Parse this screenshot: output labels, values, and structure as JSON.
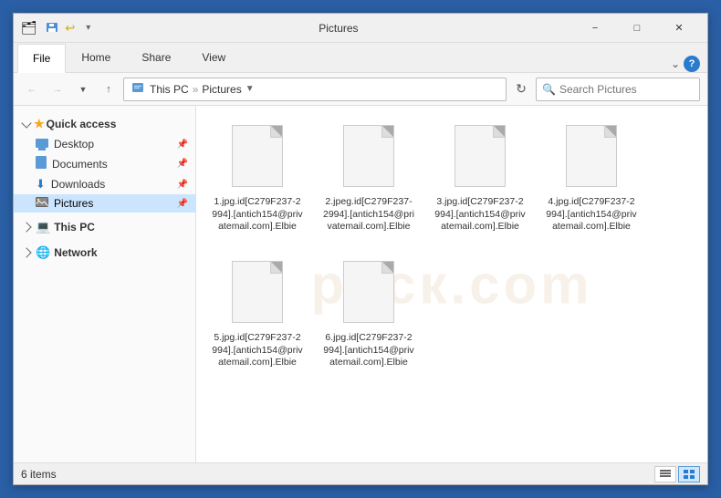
{
  "window": {
    "title": "Pictures",
    "titlebar_icon": "📁"
  },
  "ribbon": {
    "tabs": [
      "File",
      "Home",
      "Share",
      "View"
    ],
    "active_tab": "File"
  },
  "address_bar": {
    "path": [
      "This PC",
      "Pictures"
    ],
    "search_placeholder": "Search Pictures"
  },
  "sidebar": {
    "quick_access_label": "Quick access",
    "items": [
      {
        "id": "desktop",
        "label": "Desktop",
        "pinned": true
      },
      {
        "id": "documents",
        "label": "Documents",
        "pinned": true
      },
      {
        "id": "downloads",
        "label": "Downloads",
        "pinned": true
      },
      {
        "id": "pictures",
        "label": "Pictures",
        "pinned": true,
        "active": true
      }
    ],
    "this_pc_label": "This PC",
    "network_label": "Network"
  },
  "files": [
    {
      "id": "file1",
      "name": "1.jpg.id[C279F237-2994].[antich154@privatemail.com].Elbie"
    },
    {
      "id": "file2",
      "name": "2.jpeg.id[C279F237-2994].[antich154@privatemail.com].Elbie"
    },
    {
      "id": "file3",
      "name": "3.jpg.id[C279F237-2994].[antich154@privatemail.com].Elbie"
    },
    {
      "id": "file4",
      "name": "4.jpg.id[C279F237-2994].[antich154@privatemail.com].Elbie"
    },
    {
      "id": "file5",
      "name": "5.jpg.id[C279F237-2994].[antich154@privatemail.com].Elbie"
    },
    {
      "id": "file6",
      "name": "6.jpg.id[C279F237-2994].[antich154@privatemail.com].Elbie"
    }
  ],
  "status_bar": {
    "item_count": "6 items"
  },
  "watermark": "риск.com"
}
